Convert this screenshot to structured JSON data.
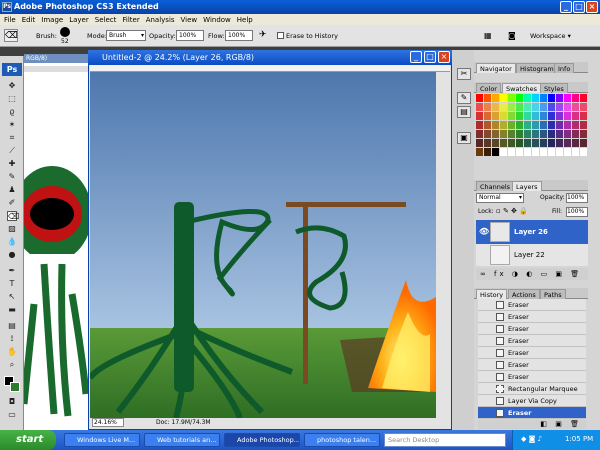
{
  "app": {
    "title": "Adobe Photoshop CS3 Extended",
    "logo": "Ps"
  },
  "menu": [
    "File",
    "Edit",
    "Image",
    "Layer",
    "Select",
    "Filter",
    "Analysis",
    "View",
    "Window",
    "Help"
  ],
  "options": {
    "brush_label": "Brush:",
    "brush_size": "52",
    "mode_label": "Mode:",
    "mode_value": "Brush",
    "opacity_label": "Opacity:",
    "opacity_value": "100%",
    "flow_label": "Flow:",
    "flow_value": "100%",
    "erase_history_label": "Erase to History",
    "workspace_label": "Workspace"
  },
  "background_doc": {
    "title_fragment": "RGB/8)"
  },
  "document": {
    "title": "Untitled-2 @ 24.2% (Layer 26, RGB/8)",
    "zoom": "24.16%",
    "doc_size": "Doc: 17.9M/74.3M"
  },
  "navigator_tabs": [
    "Navigator",
    "Histogram",
    "Info"
  ],
  "color_tabs": [
    "Color",
    "Swatches",
    "Styles"
  ],
  "layers_tabs": [
    "Channels",
    "Layers"
  ],
  "layers": {
    "blend_mode": "Normal",
    "opacity_label": "Opacity:",
    "opacity_value": "100%",
    "lock_label": "Lock:",
    "fill_label": "Fill:",
    "fill_value": "100%",
    "items": [
      "Layer 26",
      "Layer 22"
    ]
  },
  "history_tabs": [
    "History",
    "Actions",
    "Paths"
  ],
  "history": [
    "Eraser",
    "Eraser",
    "Eraser",
    "Eraser",
    "Eraser",
    "Eraser",
    "Eraser",
    "Eraser",
    "Rectangular Marquee",
    "Layer Via Copy",
    "Eraser"
  ],
  "taskbar": {
    "start_label": "start",
    "tasks": [
      "Windows Live M...",
      "Web tutorials an...",
      "Adobe Photoshop...",
      "photoshop talen..."
    ],
    "search_placeholder": "Search Desktop",
    "clock": "1:05 PM"
  },
  "colors": {
    "titlebar": "#0a4cc4",
    "selection": "#2f63c8",
    "sky": "#5f85b8",
    "grass": "#3f8a32",
    "tree": "#0e5a2a",
    "fire": "#ffaa10"
  }
}
